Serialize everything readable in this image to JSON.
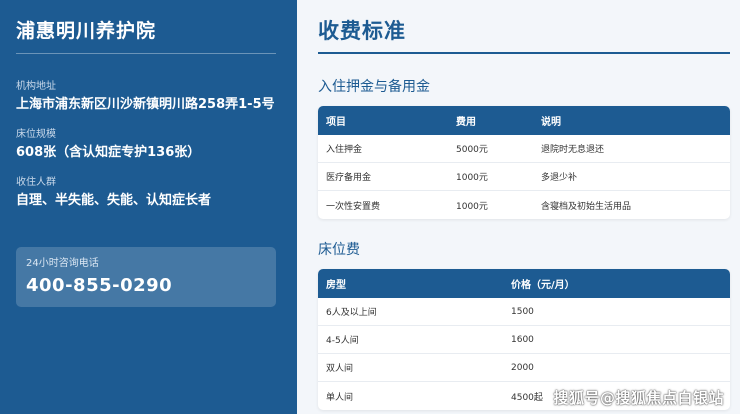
{
  "sidebar": {
    "org_name": "浦惠明川养护院",
    "address_label": "机构地址",
    "address_value": "上海市浦东新区川沙新镇明川路258弄1-5号",
    "beds_label": "床位规模",
    "beds_value": "608张（含认知症专护136张）",
    "audience_label": "收住人群",
    "audience_value": "自理、半失能、失能、认知症长者",
    "phone_label": "24小时咨询电话",
    "phone_number": "400-855-0290"
  },
  "main": {
    "title": "收费标准",
    "deposit_section": {
      "title": "入住押金与备用金",
      "headers": [
        "项目",
        "费用",
        "说明"
      ],
      "rows": [
        [
          "入住押金",
          "5000元",
          "退院时无息退还"
        ],
        [
          "医疗备用金",
          "1000元",
          "多退少补"
        ],
        [
          "一次性安置费",
          "1000元",
          "含寝档及初始生活用品"
        ]
      ]
    },
    "bed_section": {
      "title": "床位费",
      "headers": [
        "房型",
        "价格（元/月）"
      ],
      "rows": [
        [
          "6人及以上间",
          "1500"
        ],
        [
          "4-5人间",
          "1600"
        ],
        [
          "双人间",
          "2000"
        ],
        [
          "单人间",
          "4500起"
        ]
      ]
    }
  },
  "watermark": "搜狐号@搜狐焦点白银站",
  "colors": {
    "primary": "#1d5b92",
    "background": "#f3f6fa"
  }
}
